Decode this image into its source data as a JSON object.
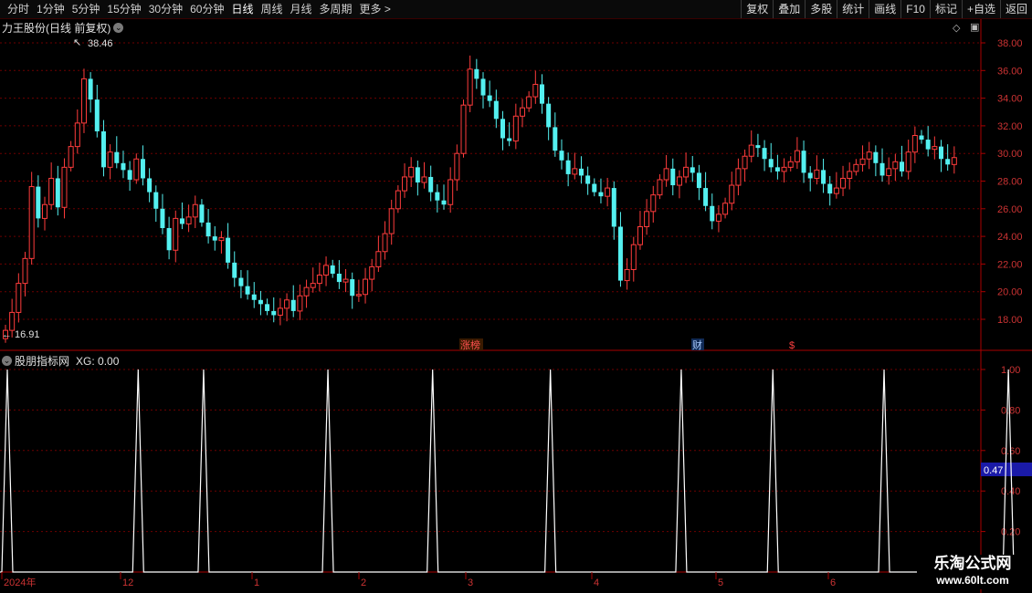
{
  "toolbar": {
    "periods": [
      "分时",
      "1分钟",
      "5分钟",
      "15分钟",
      "30分钟",
      "60分钟",
      "日线",
      "周线",
      "月线",
      "多周期",
      "更多 >"
    ],
    "active_period": "日线",
    "actions": [
      "复权",
      "叠加",
      "多股",
      "统计",
      "画线",
      "F10",
      "标记",
      "+自选",
      "返回"
    ]
  },
  "main_panel": {
    "title": "力王股份(日线 前复权)",
    "high_label": "38.46",
    "low_label": "16.91",
    "markers": {
      "zhangbang": "涨榜",
      "cai": "财",
      "dollar": "$"
    }
  },
  "sub_panel": {
    "title": "股朋指标网",
    "indicator": "XG: 0.00",
    "current_value": "0.47"
  },
  "price_axis_ticks": [
    "38.00",
    "36.00",
    "34.00",
    "32.00",
    "30.00",
    "28.00",
    "26.00",
    "24.00",
    "22.00",
    "20.00",
    "18.00"
  ],
  "indicator_axis_ticks": [
    "1.00",
    "0.80",
    "0.60",
    "0.40",
    "0.20"
  ],
  "x_axis_labels": [
    "2024年",
    "12",
    "1",
    "2",
    "3",
    "4",
    "5",
    "6"
  ],
  "logo": {
    "line1": "乐淘公式网",
    "line2": "www.60lt.com"
  },
  "colors": {
    "up": "#ff3c3c",
    "down": "#54f0f0",
    "grid": "#6e0000",
    "axis": "#aa0000",
    "line": "#ffffff",
    "accent": "#1a1aa8"
  },
  "chart_data": [
    {
      "type": "candlestick",
      "ylim": [
        16.0,
        39.0
      ],
      "x_labels": [
        "2024年",
        "12",
        "1",
        "2",
        "3",
        "4",
        "5",
        "6"
      ],
      "close": [
        17.2,
        18.5,
        20.6,
        22.4,
        27.6,
        25.3,
        26.3,
        28.2,
        26.1,
        29.0,
        30.5,
        32.2,
        35.4,
        33.9,
        31.6,
        29.0,
        30.1,
        29.3,
        28.8,
        28.1,
        29.6,
        28.2,
        27.2,
        26.0,
        24.6,
        23.0,
        25.3,
        24.9,
        25.4,
        26.3,
        25.0,
        24.0,
        23.7,
        23.9,
        22.1,
        21.0,
        20.4,
        19.8,
        19.4,
        19.1,
        18.6,
        18.3,
        18.8,
        19.4,
        18.6,
        19.7,
        20.3,
        20.6,
        21.2,
        21.9,
        21.3,
        20.7,
        20.9,
        19.7,
        19.8,
        20.9,
        21.8,
        22.9,
        24.2,
        26.0,
        27.3,
        28.3,
        29.0,
        27.9,
        28.3,
        27.2,
        26.6,
        26.3,
        28.1,
        30.0,
        33.5,
        36.1,
        35.4,
        34.2,
        33.8,
        32.5,
        31.1,
        30.9,
        32.7,
        33.3,
        34.1,
        35.0,
        33.6,
        31.9,
        30.2,
        29.5,
        28.5,
        28.9,
        28.4,
        27.8,
        27.2,
        26.9,
        27.5,
        24.7,
        20.8,
        21.6,
        23.4,
        24.7,
        25.8,
        27.0,
        28.1,
        28.9,
        27.7,
        28.3,
        29.0,
        28.6,
        27.5,
        26.2,
        25.1,
        25.6,
        26.4,
        27.7,
        28.9,
        29.8,
        30.6,
        30.4,
        29.6,
        29.0,
        28.7,
        29.0,
        29.4,
        30.2,
        28.6,
        28.2,
        28.8,
        27.8,
        27.1,
        27.5,
        28.2,
        28.7,
        29.2,
        29.6,
        30.1,
        29.3,
        28.4,
        28.9,
        29.4,
        28.7,
        30.1,
        31.3,
        31.0,
        30.3,
        30.5,
        29.6,
        29.2,
        29.7
      ]
    },
    {
      "type": "line",
      "series": [
        {
          "name": "XG",
          "peaks_at_candle": [
            0,
            20,
            30,
            49,
            65,
            83,
            103,
            117,
            134,
            153
          ]
        }
      ],
      "ylim": [
        0,
        1.0
      ]
    }
  ]
}
